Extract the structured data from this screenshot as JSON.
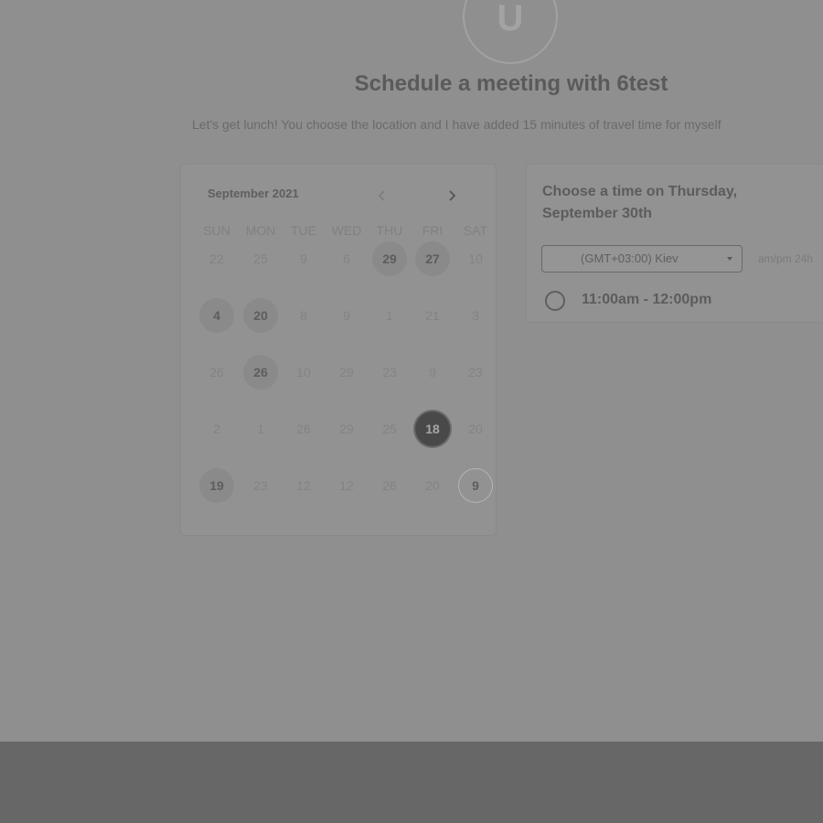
{
  "header": {
    "avatar_initial": "U",
    "title": "Schedule a meeting with 6test",
    "description": "Let's get lunch! You choose the location and I have added 15 minutes of travel time for myself"
  },
  "calendar": {
    "month_label": "September 2021",
    "weekdays": [
      "SUN",
      "MON",
      "TUE",
      "WED",
      "THU",
      "FRI",
      "SAT"
    ],
    "weeks": [
      [
        {
          "label": "22",
          "state": "muted"
        },
        {
          "label": "25",
          "state": "muted"
        },
        {
          "label": "9",
          "state": "muted"
        },
        {
          "label": "6",
          "state": "muted"
        },
        {
          "label": "29",
          "state": "available"
        },
        {
          "label": "27",
          "state": "available"
        },
        {
          "label": "10",
          "state": "muted"
        }
      ],
      [
        {
          "label": "4",
          "state": "available"
        },
        {
          "label": "20",
          "state": "available"
        },
        {
          "label": "8",
          "state": "muted"
        },
        {
          "label": "9",
          "state": "muted"
        },
        {
          "label": "1",
          "state": "muted"
        },
        {
          "label": "21",
          "state": "muted"
        },
        {
          "label": "3",
          "state": "muted"
        }
      ],
      [
        {
          "label": "26",
          "state": "muted"
        },
        {
          "label": "26",
          "state": "available"
        },
        {
          "label": "10",
          "state": "muted"
        },
        {
          "label": "29",
          "state": "muted"
        },
        {
          "label": "23",
          "state": "muted"
        },
        {
          "label": "9",
          "state": "muted"
        },
        {
          "label": "23",
          "state": "muted"
        }
      ],
      [
        {
          "label": "2",
          "state": "muted"
        },
        {
          "label": "1",
          "state": "muted"
        },
        {
          "label": "26",
          "state": "muted"
        },
        {
          "label": "29",
          "state": "muted"
        },
        {
          "label": "25",
          "state": "muted"
        },
        {
          "label": "18",
          "state": "selected"
        },
        {
          "label": "20",
          "state": "muted"
        }
      ],
      [
        {
          "label": "19",
          "state": "available"
        },
        {
          "label": "23",
          "state": "muted"
        },
        {
          "label": "12",
          "state": "normal"
        },
        {
          "label": "12",
          "state": "normal"
        },
        {
          "label": "26",
          "state": "muted"
        },
        {
          "label": "20",
          "state": "muted"
        },
        {
          "label": "9",
          "state": "today"
        }
      ]
    ]
  },
  "time_panel": {
    "heading": "Choose a time on Thursday, September 30th",
    "timezone": "(GMT+03:00) Kiev",
    "format_options": "am/pm  24h",
    "slots": [
      {
        "label": "11:00am - 12:00pm"
      }
    ]
  }
}
